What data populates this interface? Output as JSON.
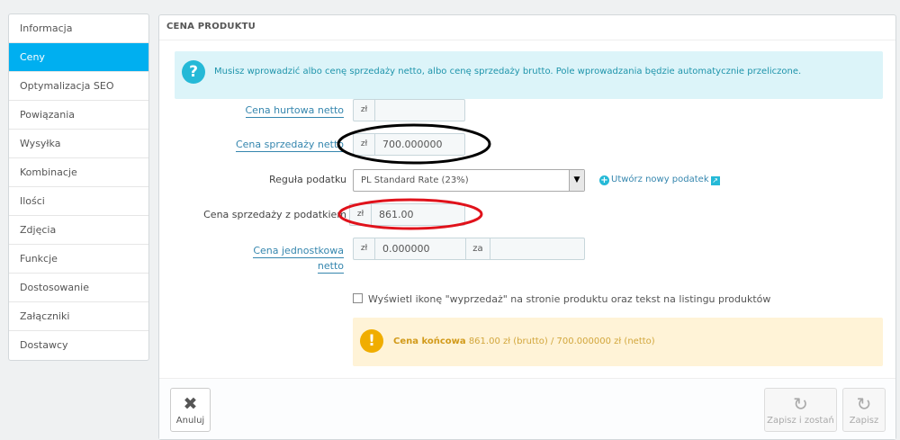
{
  "sidebar": {
    "items": [
      {
        "label": "Informacja"
      },
      {
        "label": "Ceny"
      },
      {
        "label": "Optymalizacja SEO"
      },
      {
        "label": "Powiązania"
      },
      {
        "label": "Wysyłka"
      },
      {
        "label": "Kombinacje"
      },
      {
        "label": "Ilości"
      },
      {
        "label": "Zdjęcia"
      },
      {
        "label": "Funkcje"
      },
      {
        "label": "Dostosowanie"
      },
      {
        "label": "Załączniki"
      },
      {
        "label": "Dostawcy"
      }
    ],
    "active": "Ceny"
  },
  "panel": {
    "title": "CENA PRODUKTU",
    "info": "Musisz wprowadzić albo cenę sprzedaży netto, albo cenę sprzedaży brutto. Pole wprowadzania będzie automatycznie przeliczone.",
    "fields": {
      "wholesale": {
        "label": "Cena hurtowa netto",
        "currency": "zł",
        "value": ""
      },
      "net_price": {
        "label": "Cena sprzedaży netto",
        "currency": "zł",
        "value": "700.000000"
      },
      "tax_rule": {
        "label": "Reguła podatku",
        "value": "PL Standard Rate (23%)",
        "new_tax_link": "Utwórz nowy podatek"
      },
      "gross_price": {
        "label": "Cena sprzedaży z podatkiem",
        "currency": "zł",
        "value": "861.00"
      },
      "unit_price": {
        "label_line1": "Cena jednostkowa",
        "label_line2": "netto",
        "currency": "zł",
        "value": "0.000000",
        "per_label": "za",
        "per_value": ""
      }
    },
    "on_sale_checkbox": {
      "label": "Wyświetl ikonę \"wyprzedaż\" na stronie produktu oraz tekst na listingu produktów",
      "checked": false
    },
    "final_price": {
      "label": "Cena końcowa",
      "text": "861.00 zł (brutto) / 700.000000 zł (netto)"
    }
  },
  "footer": {
    "cancel": "Anuluj",
    "save_and_stay": "Zapisz i zostań",
    "save": "Zapisz"
  },
  "colors": {
    "accent": "#00aff0",
    "info_bg": "#dcf4f9",
    "warning_bg": "#fff3d7",
    "black_ellipse": "#000000",
    "red_ellipse": "#e0121b"
  }
}
